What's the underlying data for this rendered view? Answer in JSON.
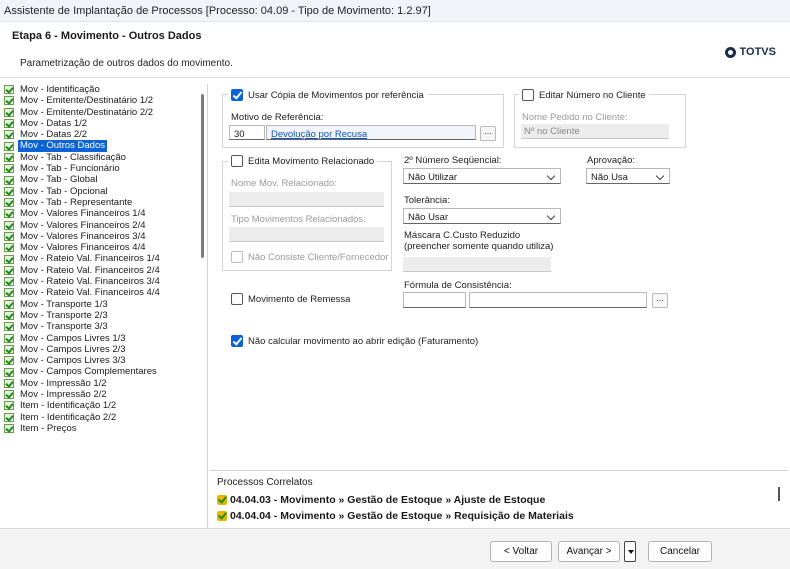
{
  "window": {
    "title": "Assistente de Implantação de Processos [Processo: 04.09 - Tipo de Movimento: 1.2.97]"
  },
  "header": {
    "step_title": "Etapa 6 - Movimento - Outros Dados",
    "subtitle": "Parametrização de outros dados do movimento.",
    "logo_text": "TOTVS"
  },
  "tree": {
    "items": [
      "Mov - Identificação",
      "Mov - Emitente/Destinatário 1/2",
      "Mov - Emitente/Destinatário 2/2",
      "Mov - Datas 1/2",
      "Mov - Datas 2/2",
      "Mov - Outros Dados",
      "Mov - Tab - Classificação",
      "Mov - Tab - Funcionário",
      "Mov - Tab - Global",
      "Mov - Tab - Opcional",
      "Mov - Tab - Representante",
      "Mov - Valores Financeiros 1/4",
      "Mov - Valores Financeiros 2/4",
      "Mov - Valores Financeiros 3/4",
      "Mov - Valores Financeiros 4/4",
      "Mov - Rateio Val. Financeiros 1/4",
      "Mov - Rateio Val. Financeiros 2/4",
      "Mov - Rateio Val. Financeiros 3/4",
      "Mov - Rateio Val. Financeiros 4/4",
      "Mov - Transporte 1/3",
      "Mov - Transporte 2/3",
      "Mov - Transporte 3/3",
      "Mov - Campos Livres 1/3",
      "Mov - Campos Livres 2/3",
      "Mov - Campos Livres 3/3",
      "Mov - Campos Complementares",
      "Mov - Impressão 1/2",
      "Mov - Impressão 2/2",
      "Item - Identificação 1/2",
      "Item - Identificação 2/2",
      "Item - Preços"
    ],
    "selected_index": 5
  },
  "form": {
    "usar_copia": {
      "label": "Usar Cópia de Movimentos por referência",
      "checked": true
    },
    "motivo_referencia": {
      "label": "Motivo de Referência:",
      "code": "30",
      "description": "Devolução por Recusa",
      "browse": "..."
    },
    "editar_numero": {
      "label": "Editar Número no Cliente",
      "checked": false
    },
    "nome_pedido": {
      "label": "Nome Pedido no Cliente:",
      "value": "Nº no Cliente"
    },
    "edita_relacionado": {
      "label": "Edita Movimento Relacionado",
      "checked": false
    },
    "nome_mov_relacionado": {
      "label": "Nome Mov. Relacionado:"
    },
    "tipo_mov_relacionados": {
      "label": "Tipo Movimentos Relacionados:"
    },
    "nao_consiste": {
      "label": "Não Consiste Cliente/Fornecedor",
      "checked": false
    },
    "segundo_numero": {
      "label": "2º Número Seqüencial:",
      "value": "Não Utilizar"
    },
    "aprovacao": {
      "label": "Aprovação:",
      "value": "Não Usa"
    },
    "tolerancia": {
      "label": "Tolerância:",
      "value": "Não Usar"
    },
    "mascara": {
      "label_line1": "Máscara C.Custo Reduzido",
      "label_line2": "(preencher somente quando utiliza)"
    },
    "movimento_remessa": {
      "label": "Movimento de Remessa",
      "checked": false
    },
    "formula_consistencia": {
      "label": "Fórmula de Consistência:",
      "browse": "..."
    },
    "nao_calcular": {
      "label": "Não calcular movimento ao abrir edição (Faturamento)",
      "checked": true
    }
  },
  "correlatos": {
    "title": "Processos Correlatos",
    "items": [
      "04.04.03 - Movimento » Gestão de Estoque » Ajuste de Estoque",
      "04.04.04 - Movimento » Gestão de Estoque » Requisição de Materiais"
    ]
  },
  "footer": {
    "back": "< Voltar",
    "next": "Avançar >",
    "cancel": "Cancelar"
  },
  "colors": {
    "accent": "#0b63d6",
    "link": "#0b53c0",
    "check_green": "#1e8a1e"
  }
}
